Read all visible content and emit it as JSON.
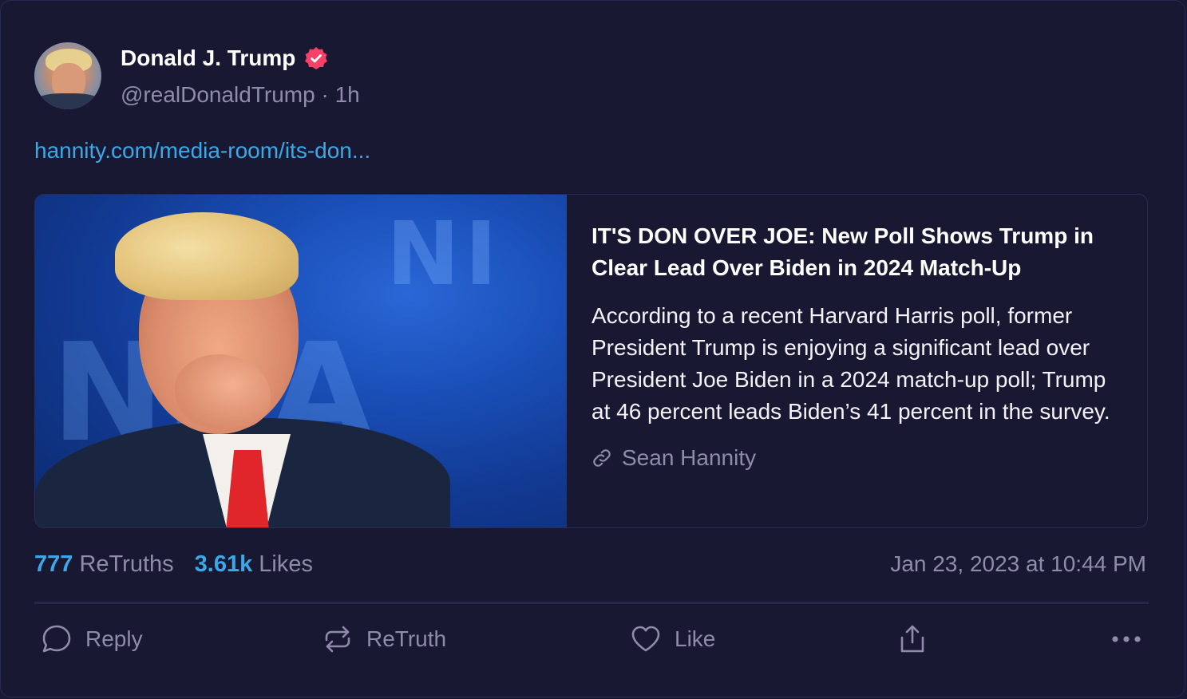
{
  "post": {
    "author": {
      "display_name": "Donald J. Trump",
      "handle": "@realDonaldTrump",
      "age": "1h",
      "verified_color": "#f64067"
    },
    "link_text": "hannity.com/media-room/its-don...",
    "card": {
      "title": "IT'S DON OVER JOE: New Poll Shows Trump in Clear Lead Over Biden in 2024 Match-Up",
      "description": "According to a recent Harvard Harris poll, former President Trump is enjoying a significant lead over President Joe Biden in a 2024 match-up poll; Trump at 46 percent leads Biden’s 41 percent in the survey.",
      "source": "Sean Hannity"
    },
    "stats": {
      "retruths_count": "777",
      "retruths_label": "ReTruths",
      "likes_count": "3.61k",
      "likes_label": "Likes"
    },
    "timestamp": "Jan 23, 2023 at 10:44 PM",
    "actions": {
      "reply": "Reply",
      "retruth": "ReTruth",
      "like": "Like"
    }
  },
  "icons": {
    "verified": "verified-badge-icon",
    "link": "link-icon",
    "reply": "speech-bubble-icon",
    "retruth": "repost-arrows-icon",
    "like": "heart-icon",
    "share": "share-upload-icon",
    "more": "ellipsis-icon"
  },
  "colors": {
    "background": "#191833",
    "accent": "#3aa9e8",
    "muted": "#8e8ca8"
  }
}
